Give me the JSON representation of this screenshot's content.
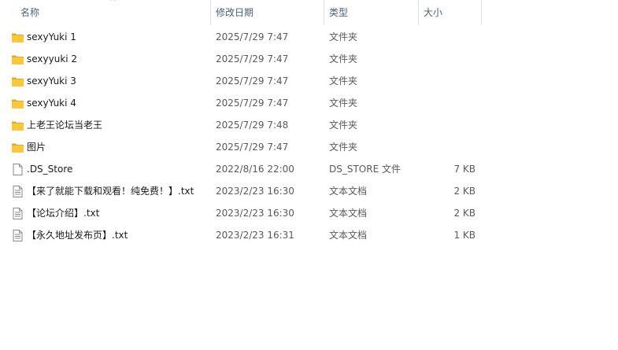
{
  "columns": {
    "name": "名称",
    "date": "修改日期",
    "type": "类型",
    "size": "大小",
    "sort_indicator": "^"
  },
  "files": [
    {
      "name": "sexyYuki 1",
      "date": "2025/7/29 7:47",
      "type": "文件夹",
      "size": "",
      "icon": "folder-icon"
    },
    {
      "name": "sexyyuki 2",
      "date": "2025/7/29 7:47",
      "type": "文件夹",
      "size": "",
      "icon": "folder-icon"
    },
    {
      "name": "sexyYuki 3",
      "date": "2025/7/29 7:47",
      "type": "文件夹",
      "size": "",
      "icon": "folder-icon"
    },
    {
      "name": "sexyYuki 4",
      "date": "2025/7/29 7:47",
      "type": "文件夹",
      "size": "",
      "icon": "folder-icon"
    },
    {
      "name": "上老王论坛当老王",
      "date": "2025/7/29 7:48",
      "type": "文件夹",
      "size": "",
      "icon": "folder-icon"
    },
    {
      "name": "图片",
      "date": "2025/7/29 7:47",
      "type": "文件夹",
      "size": "",
      "icon": "folder-icon"
    },
    {
      "name": ".DS_Store",
      "date": "2022/8/16 22:00",
      "type": "DS_STORE 文件",
      "size": "7 KB",
      "icon": "blank-file-icon"
    },
    {
      "name": "【来了就能下载和观看！纯免费！】.txt",
      "date": "2023/2/23 16:30",
      "type": "文本文档",
      "size": "2 KB",
      "icon": "text-file-icon"
    },
    {
      "name": "【论坛介绍】.txt",
      "date": "2023/2/23 16:30",
      "type": "文本文档",
      "size": "2 KB",
      "icon": "text-file-icon"
    },
    {
      "name": "【永久地址发布页】.txt",
      "date": "2023/2/23 16:31",
      "type": "文本文档",
      "size": "1 KB",
      "icon": "text-file-icon"
    }
  ],
  "colors": {
    "folder": "#f8c93e",
    "folder_dark": "#e7ac1e",
    "header_text": "#4c607a"
  }
}
